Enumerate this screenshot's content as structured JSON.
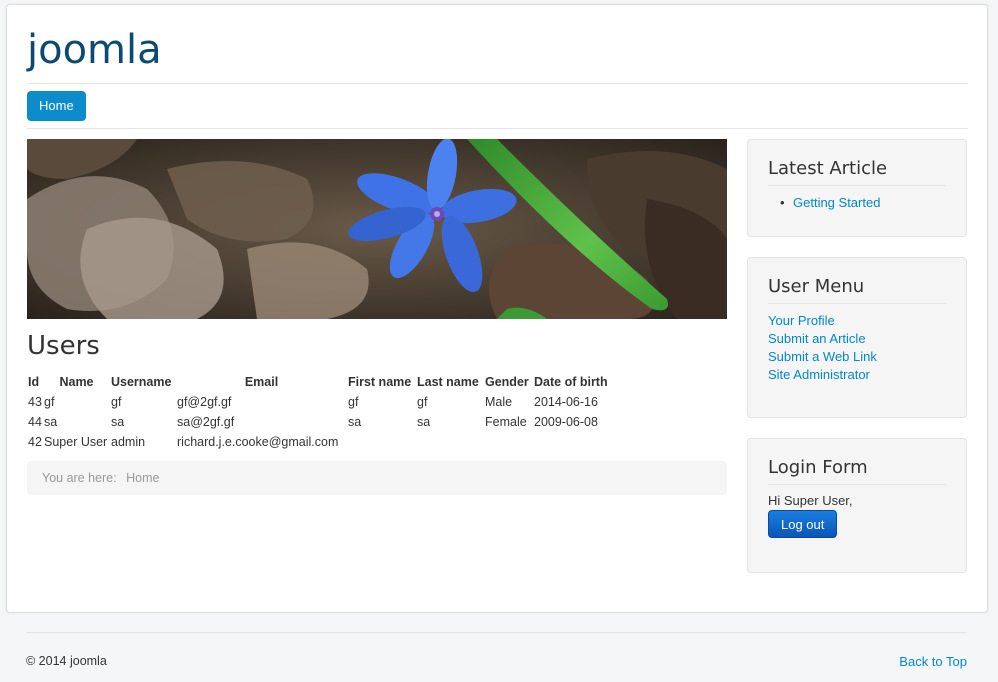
{
  "site": {
    "title": "joomla"
  },
  "nav": {
    "items": [
      {
        "label": "Home"
      }
    ]
  },
  "users": {
    "heading": "Users",
    "columns": [
      "Id",
      "Name",
      "Username",
      "Email",
      "First name",
      "Last name",
      "Gender",
      "Date of birth"
    ],
    "rows": [
      [
        "43",
        "gf",
        "gf",
        "gf@2gf.gf",
        "gf",
        "gf",
        "Male",
        "2014-06-16"
      ],
      [
        "44",
        "sa",
        "sa",
        "sa@2gf.gf",
        "sa",
        "sa",
        "Female",
        "2009-06-08"
      ],
      [
        "42",
        "Super User",
        "admin",
        "richard.j.e.cooke@gmail.com",
        "",
        "",
        "",
        ""
      ]
    ]
  },
  "breadcrumb": {
    "prefix": "You are here:",
    "current": "Home"
  },
  "sidebar": {
    "latest": {
      "title": "Latest Article",
      "items": [
        "Getting Started"
      ]
    },
    "user_menu": {
      "title": "User Menu",
      "items": [
        "Your Profile",
        "Submit an Article",
        "Submit a Web Link",
        "Site Administrator"
      ]
    },
    "login": {
      "title": "Login Form",
      "greeting": "Hi Super User,",
      "logout_label": "Log out"
    }
  },
  "footer": {
    "copyright": "© 2014 joomla",
    "back_to_top": "Back to Top"
  },
  "colors": {
    "accent": "#0088cc",
    "title": "#0b4a72",
    "nav_bg": "#0d8ccc",
    "logout_bg": "#0a55b8"
  }
}
